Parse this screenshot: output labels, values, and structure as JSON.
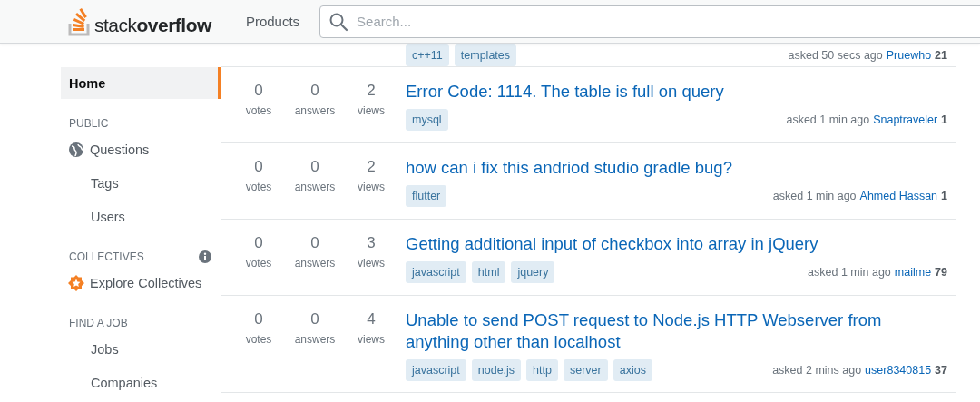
{
  "header": {
    "logo": {
      "light": "stack",
      "bold": "overflow"
    },
    "nav": [
      "Products"
    ],
    "search": {
      "placeholder": "Search..."
    }
  },
  "sidebar": {
    "items": [
      {
        "kind": "link",
        "label": "Home",
        "selected": true
      },
      {
        "kind": "heading",
        "label": "PUBLIC"
      },
      {
        "kind": "link",
        "label": "Questions",
        "selected": false
      },
      {
        "kind": "link",
        "label": "Tags",
        "selected": false
      },
      {
        "kind": "link",
        "label": "Users",
        "selected": false
      },
      {
        "kind": "heading",
        "label": "COLLECTIVES",
        "info": true
      },
      {
        "kind": "link",
        "label": "Explore Collectives",
        "selected": false
      },
      {
        "kind": "heading",
        "label": "FIND A JOB"
      },
      {
        "kind": "link",
        "label": "Jobs",
        "selected": false
      },
      {
        "kind": "link",
        "label": "Companies",
        "selected": false
      }
    ]
  },
  "questions": [
    {
      "tags": [
        "c++11",
        "templates"
      ],
      "asked": "asked 50 secs ago",
      "user": "Pruewho",
      "reputation": "21"
    },
    {
      "votes": "0",
      "votes_label": "votes",
      "answers": "0",
      "answers_label": "answers",
      "views": "2",
      "views_label": "views",
      "title": "Error Code: 1114. The table is full on query",
      "tags": [
        "mysql"
      ],
      "asked": "asked 1 min ago",
      "user": "Snaptraveler",
      "reputation": "1"
    },
    {
      "votes": "0",
      "votes_label": "votes",
      "answers": "0",
      "answers_label": "answers",
      "views": "2",
      "views_label": "views",
      "title": "how can i fix this andriod studio gradle bug?",
      "tags": [
        "flutter"
      ],
      "asked": "asked 1 min ago",
      "user": "Ahmed Hassan",
      "reputation": "1"
    },
    {
      "votes": "0",
      "votes_label": "votes",
      "answers": "0",
      "answers_label": "answers",
      "views": "3",
      "views_label": "views",
      "title": "Getting additional input of checkbox into array in jQuery",
      "tags": [
        "javascript",
        "html",
        "jquery"
      ],
      "asked": "asked 1 min ago",
      "user": "mailme",
      "reputation": "79"
    },
    {
      "votes": "0",
      "votes_label": "votes",
      "answers": "0",
      "answers_label": "answers",
      "views": "4",
      "views_label": "views",
      "title": "Unable to send POST request to Node.js HTTP Webserver from anything other than localhost",
      "tags": [
        "javascript",
        "node.js",
        "http",
        "server",
        "axios"
      ],
      "asked": "asked 2 mins ago",
      "user": "user8340815",
      "reputation": "37"
    }
  ]
}
